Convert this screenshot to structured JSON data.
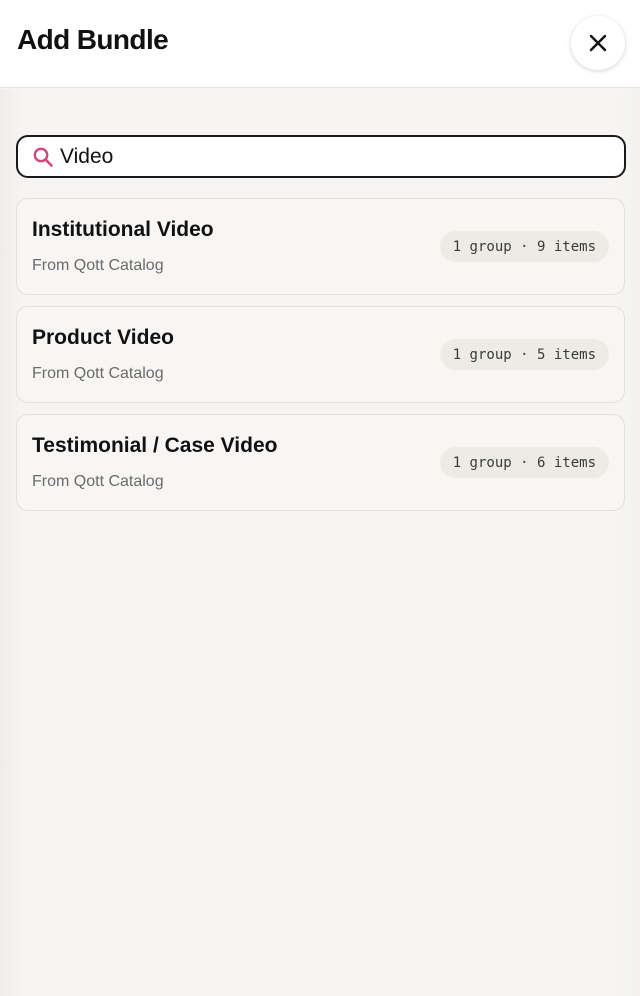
{
  "header": {
    "title": "Add Bundle",
    "close_icon": "close-icon"
  },
  "search": {
    "icon": "search-icon",
    "value": "Video",
    "placeholder": "",
    "icon_color": "#d4467e"
  },
  "bundles": [
    {
      "name": "Institutional Video",
      "source": "From Qott Catalog",
      "badge": "1 group · 9 items"
    },
    {
      "name": "Product Video",
      "source": "From Qott Catalog",
      "badge": "1 group · 5 items"
    },
    {
      "name": "Testimonial / Case Video",
      "source": "From Qott Catalog",
      "badge": "1 group · 6 items"
    }
  ]
}
